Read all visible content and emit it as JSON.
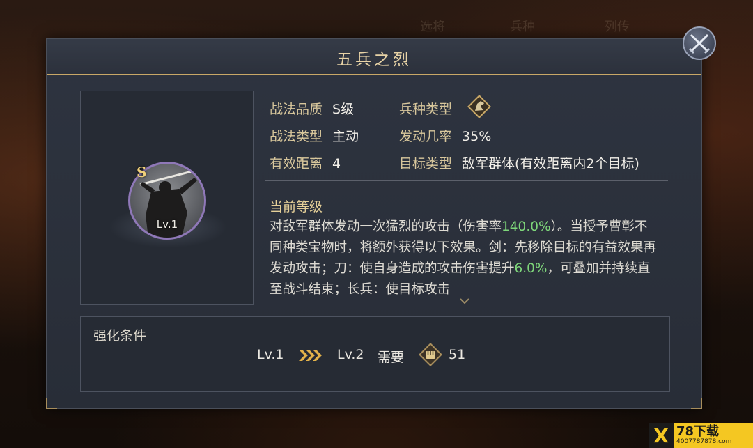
{
  "background": {
    "tabs": [
      "选将",
      "兵种",
      "列传"
    ]
  },
  "dialog": {
    "title": "五兵之烈",
    "close_icon": "crossed-swords-close-icon"
  },
  "skill": {
    "grade_badge": "S",
    "level": "Lv.1",
    "portrait": "spear-general-silhouette"
  },
  "attributes": {
    "quality": {
      "label": "战法品质",
      "value": "S级"
    },
    "troop_type": {
      "label": "兵种类型",
      "icon": "horse-head-icon"
    },
    "skill_type": {
      "label": "战法类型",
      "value": "主动"
    },
    "trigger_rate": {
      "label": "发动几率",
      "value": "35%"
    },
    "range": {
      "label": "有效距离",
      "value": "4"
    },
    "target_type": {
      "label": "目标类型",
      "value": "敌军群体(有效距离内2个目标)"
    }
  },
  "current_level": {
    "heading": "当前等级",
    "segments": [
      "对敌军群体发动一次猛烈的攻击（伤害率",
      "140.0%",
      "）。当授予曹彰不同种类宝物时，将额外获得以下效果。剑：先移除目标的有益效果再发动攻击；刀：使自身造成的攻击伤害提升",
      "6.0%",
      "，可叠加并持续直至战斗结束；长兵：使目标攻击"
    ]
  },
  "enhance": {
    "title": "强化条件",
    "from_level": "Lv.1",
    "to_level": "Lv.2",
    "need_label": "需要",
    "cost": "51",
    "cost_icon": "fist-token-icon"
  },
  "watermark": {
    "main": "78下载",
    "sub": "4007787878.com"
  },
  "colors": {
    "accent_gold": "#e8d3a6",
    "highlight_green": "#7ed67a",
    "ring_purple": "#8f78b8"
  }
}
